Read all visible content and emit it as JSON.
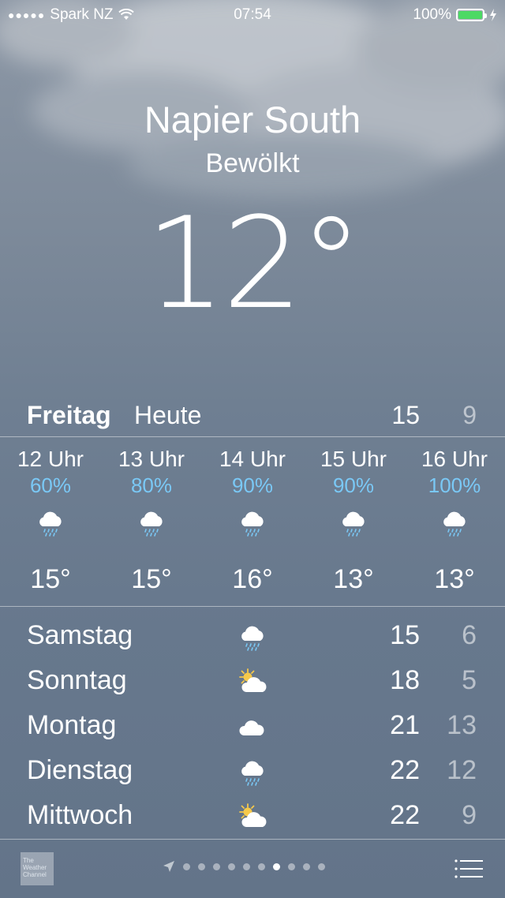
{
  "status_bar": {
    "carrier": "Spark NZ",
    "time": "07:54",
    "battery_percent": "100%",
    "battery_color": "#4cd964"
  },
  "location": {
    "city": "Napier South",
    "condition": "Bewölkt",
    "temperature": "12°"
  },
  "today": {
    "day": "Freitag",
    "label": "Heute",
    "high": "15",
    "low": "9"
  },
  "hourly": [
    {
      "time": "12 Uhr",
      "precip": "60%",
      "icon": "rain-cloud-icon",
      "temp": "15°"
    },
    {
      "time": "13 Uhr",
      "precip": "80%",
      "icon": "rain-cloud-icon",
      "temp": "15°"
    },
    {
      "time": "14 Uhr",
      "precip": "90%",
      "icon": "rain-cloud-icon",
      "temp": "16°"
    },
    {
      "time": "15 Uhr",
      "precip": "90%",
      "icon": "rain-cloud-icon",
      "temp": "13°"
    },
    {
      "time": "16 Uhr",
      "precip": "100%",
      "icon": "rain-cloud-icon",
      "temp": "13°"
    }
  ],
  "daily": [
    {
      "day": "Samstag",
      "icon": "rain-cloud-icon",
      "high": "15",
      "low": "6"
    },
    {
      "day": "Sonntag",
      "icon": "partly-sunny-icon",
      "high": "18",
      "low": "5"
    },
    {
      "day": "Montag",
      "icon": "cloud-icon",
      "high": "21",
      "low": "13"
    },
    {
      "day": "Dienstag",
      "icon": "rain-cloud-icon",
      "high": "22",
      "low": "12"
    },
    {
      "day": "Mittwoch",
      "icon": "partly-sunny-icon",
      "high": "22",
      "low": "9"
    }
  ],
  "footer": {
    "logo_text": "The Weather Channel",
    "page_count": 10,
    "active_page": 7,
    "precip_color": "#7ac8f5"
  }
}
